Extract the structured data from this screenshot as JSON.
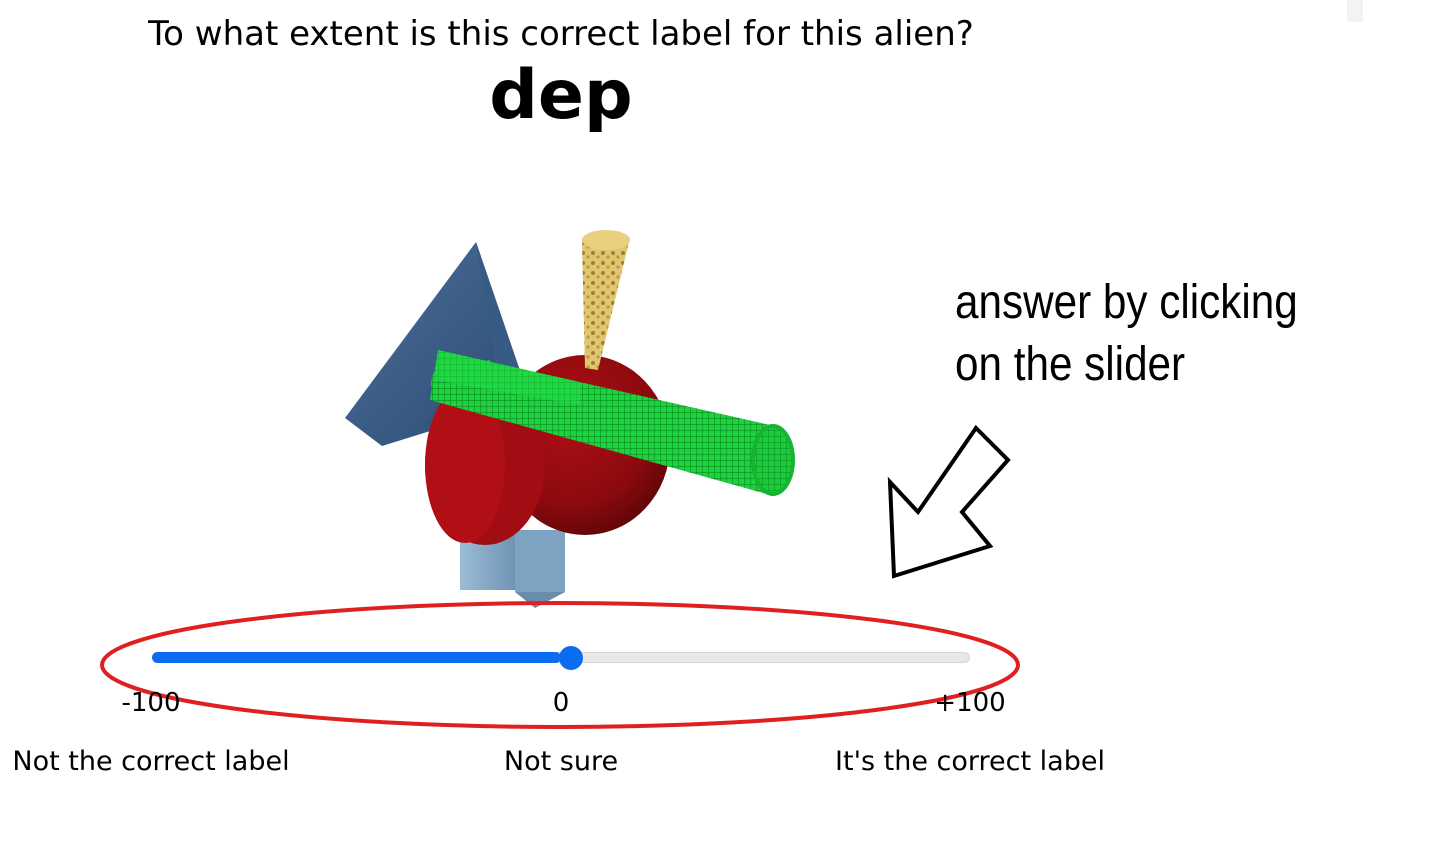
{
  "question": "To what extent is this correct label for this alien?",
  "label_word": "dep",
  "instruction": {
    "line1": "answer by clicking",
    "line2": "on the slider"
  },
  "slider": {
    "min": -100,
    "max": 100,
    "value": 0,
    "min_label": "-100",
    "mid_label": "0",
    "max_label": "+100",
    "fill_color": "#0b6cf0"
  },
  "anchors": {
    "left": "Not the correct label",
    "middle": "Not sure",
    "right": "It's the correct label"
  },
  "highlight_color": "#e02020"
}
